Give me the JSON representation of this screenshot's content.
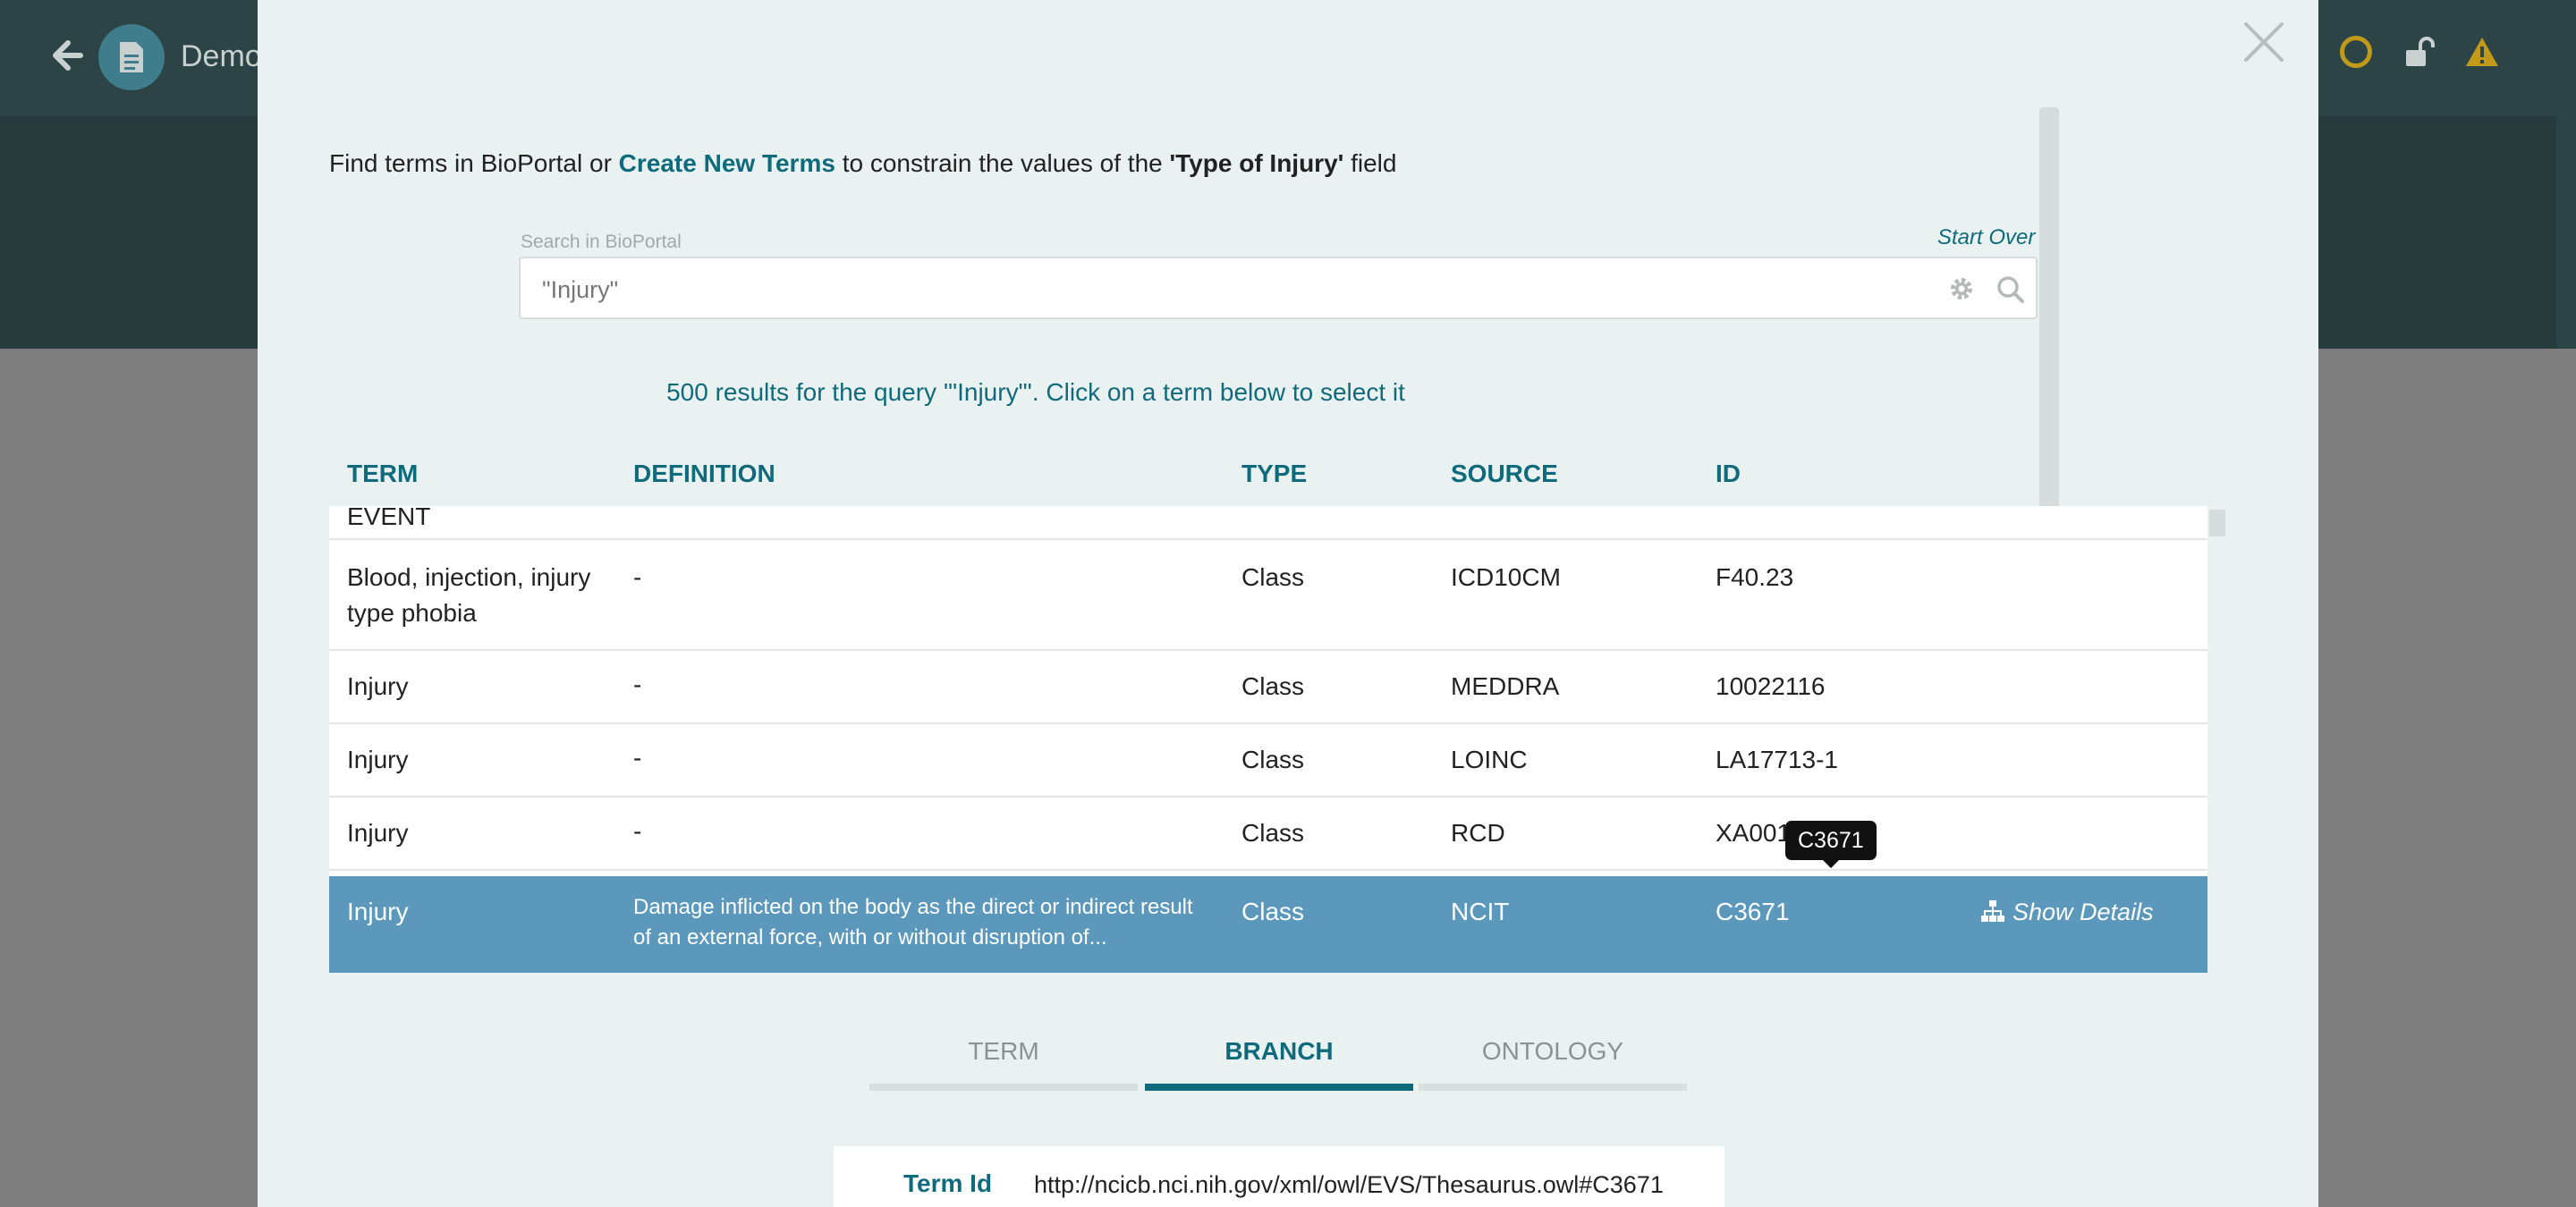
{
  "app": {
    "title": "Demo",
    "colors": {
      "accent": "#0f6b7c",
      "selected_row": "#5b98bb",
      "header": "#2c4446"
    }
  },
  "modal": {
    "intro": {
      "prefix": "Find terms in BioPortal or",
      "link": "Create New Terms",
      "middle": "to constrain the values of the",
      "field": "'Type of Injury'",
      "suffix": "field"
    },
    "search": {
      "label": "Search in BioPortal",
      "value": "\"Injury\"",
      "start_over": "Start Over"
    },
    "results_message": "500 results for the query '\"Injury\"'. Click on a term below to select it",
    "table": {
      "columns": [
        "TERM",
        "DEFINITION",
        "TYPE",
        "SOURCE",
        "ID"
      ],
      "partial_row": {
        "term": "EVENT"
      },
      "rows": [
        {
          "term": "Blood, injection, injury type phobia",
          "definition": "-",
          "type": "Class",
          "source": "ICD10CM",
          "id": "F40.23"
        },
        {
          "term": "Injury",
          "definition": "-",
          "type": "Class",
          "source": "MEDDRA",
          "id": "10022116"
        },
        {
          "term": "Injury",
          "definition": "-",
          "type": "Class",
          "source": "LOINC",
          "id": "LA17713-1"
        },
        {
          "term": "Injury",
          "definition": "-",
          "type": "Class",
          "source": "RCD",
          "id": "XA001"
        },
        {
          "term": "Injury",
          "definition": "Damage inflicted on the body as the direct or indirect result of an external force, with or without disruption of...",
          "type": "Class",
          "source": "NCIT",
          "id": "C3671",
          "selected": true
        }
      ],
      "tooltip": "C3671",
      "show_details": "Show Details"
    },
    "tabs": [
      {
        "label": "TERM",
        "active": false
      },
      {
        "label": "BRANCH",
        "active": true
      },
      {
        "label": "ONTOLOGY",
        "active": false
      }
    ],
    "detail": {
      "label": "Term Id",
      "value": "http://ncicb.nci.nih.gov/xml/owl/EVS/Thesaurus.owl#C3671"
    }
  }
}
